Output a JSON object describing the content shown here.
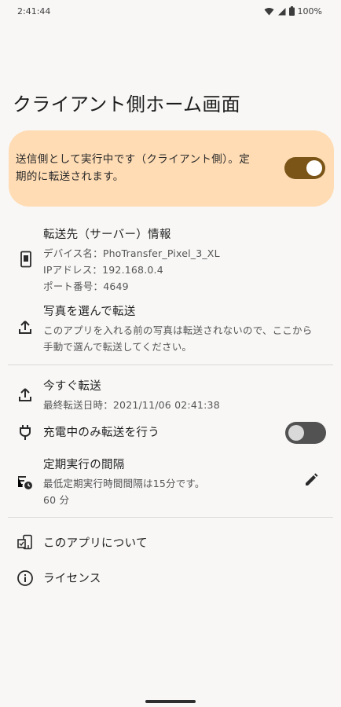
{
  "status_bar": {
    "time": "2:41:44",
    "battery": "100%"
  },
  "page_title": "クライアント側ホーム画面",
  "banner": {
    "text": "送信側として実行中です（クライアント側）。定期的に転送されます。",
    "switch_on": true,
    "accent_color": "#7a5517",
    "background_color": "#ffdcb4"
  },
  "server_info": {
    "title": "転送先（サーバー）情報",
    "device_name": "デバイス名：PhoTransfer_Pixel_3_XL",
    "ip_address": "IPアドレス：192.168.0.4",
    "port": "ポート番号：4649"
  },
  "select_transfer": {
    "title": "写真を選んで転送",
    "description": "このアプリを入れる前の写真は転送されないので、ここから手動で選んで転送してください。"
  },
  "transfer_now": {
    "title": "今すぐ転送",
    "last_transfer": "最終転送日時：2021/11/06 02:41:38"
  },
  "charging_only": {
    "title": "充電中のみ転送を行う",
    "switch_on": false
  },
  "interval": {
    "title": "定期実行の間隔",
    "note": "最低定期実行時間間隔は15分です。",
    "value": "60 分"
  },
  "about": {
    "label": "このアプリについて"
  },
  "license": {
    "label": "ライセンス"
  },
  "icons": {
    "server": "phone-device-icon",
    "select": "upload-icon",
    "now": "upload-icon",
    "charging": "power-plug-icon",
    "interval": "schedule-icon",
    "edit": "pencil-icon",
    "about": "app-info-icon",
    "license": "info-icon"
  }
}
